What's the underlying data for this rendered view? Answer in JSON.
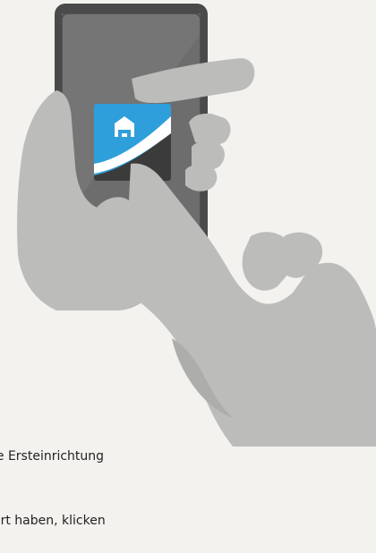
{
  "illustration": {
    "app_icon": "home-app-icon",
    "accent_color": "#2f9fdc",
    "phone_color": "#555555",
    "hand_color": "#bdbdbb"
  },
  "instruction": {
    "line_1": "ie Ersteinrichtung",
    "line_2": "ert haben, klicken"
  }
}
